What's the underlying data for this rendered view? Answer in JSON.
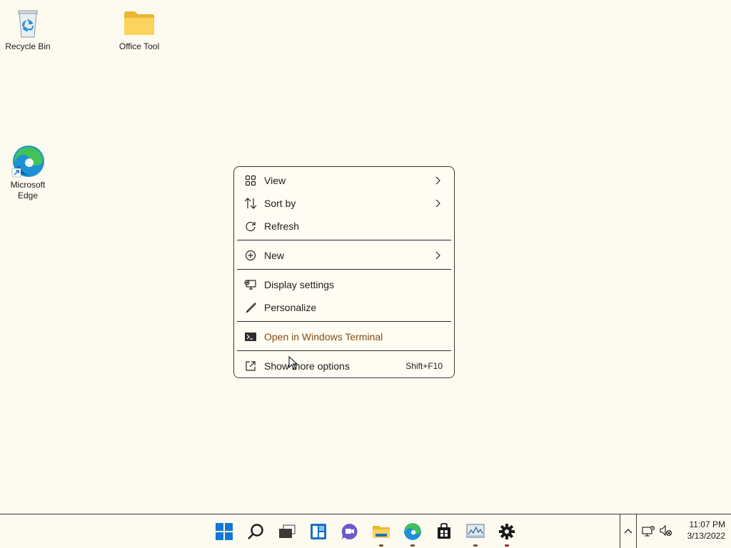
{
  "desktop": {
    "icons": [
      {
        "label": "Recycle Bin",
        "icon": "recycle-bin-icon"
      },
      {
        "label": "Office Tool",
        "icon": "folder-icon"
      },
      {
        "label": "Microsoft Edge",
        "icon": "edge-icon"
      }
    ]
  },
  "context_menu": {
    "items": [
      {
        "label": "View",
        "icon": "view-grid-icon",
        "submenu": true
      },
      {
        "label": "Sort by",
        "icon": "sort-icon",
        "submenu": true
      },
      {
        "label": "Refresh",
        "icon": "refresh-icon"
      },
      {
        "label": "New",
        "icon": "new-plus-icon",
        "submenu": true
      },
      {
        "label": "Display settings",
        "icon": "display-settings-icon"
      },
      {
        "label": "Personalize",
        "icon": "brush-icon"
      },
      {
        "label": "Open in Windows Terminal",
        "icon": "terminal-icon"
      },
      {
        "label": "Show more options",
        "icon": "more-options-icon",
        "shortcut": "Shift+F10"
      }
    ]
  },
  "taskbar": {
    "buttons": [
      {
        "name": "start",
        "icon": "windows-logo-icon"
      },
      {
        "name": "search",
        "icon": "search-icon"
      },
      {
        "name": "task-view",
        "icon": "task-view-icon"
      },
      {
        "name": "widgets",
        "icon": "widgets-icon"
      },
      {
        "name": "chat",
        "icon": "chat-icon"
      },
      {
        "name": "file-explorer",
        "icon": "file-explorer-icon",
        "running": true
      },
      {
        "name": "edge",
        "icon": "edge-icon",
        "running": true
      },
      {
        "name": "store",
        "icon": "store-icon"
      },
      {
        "name": "resource-monitor",
        "icon": "monitor-chart-icon",
        "running": true
      },
      {
        "name": "settings",
        "icon": "gear-icon",
        "running": true
      }
    ],
    "tray": {
      "time": "11:07 PM",
      "date": "3/13/2022"
    }
  },
  "colors": {
    "background": "#fdfaf0",
    "accent": "#0067c0",
    "terminal_text": "#8a4a12"
  }
}
